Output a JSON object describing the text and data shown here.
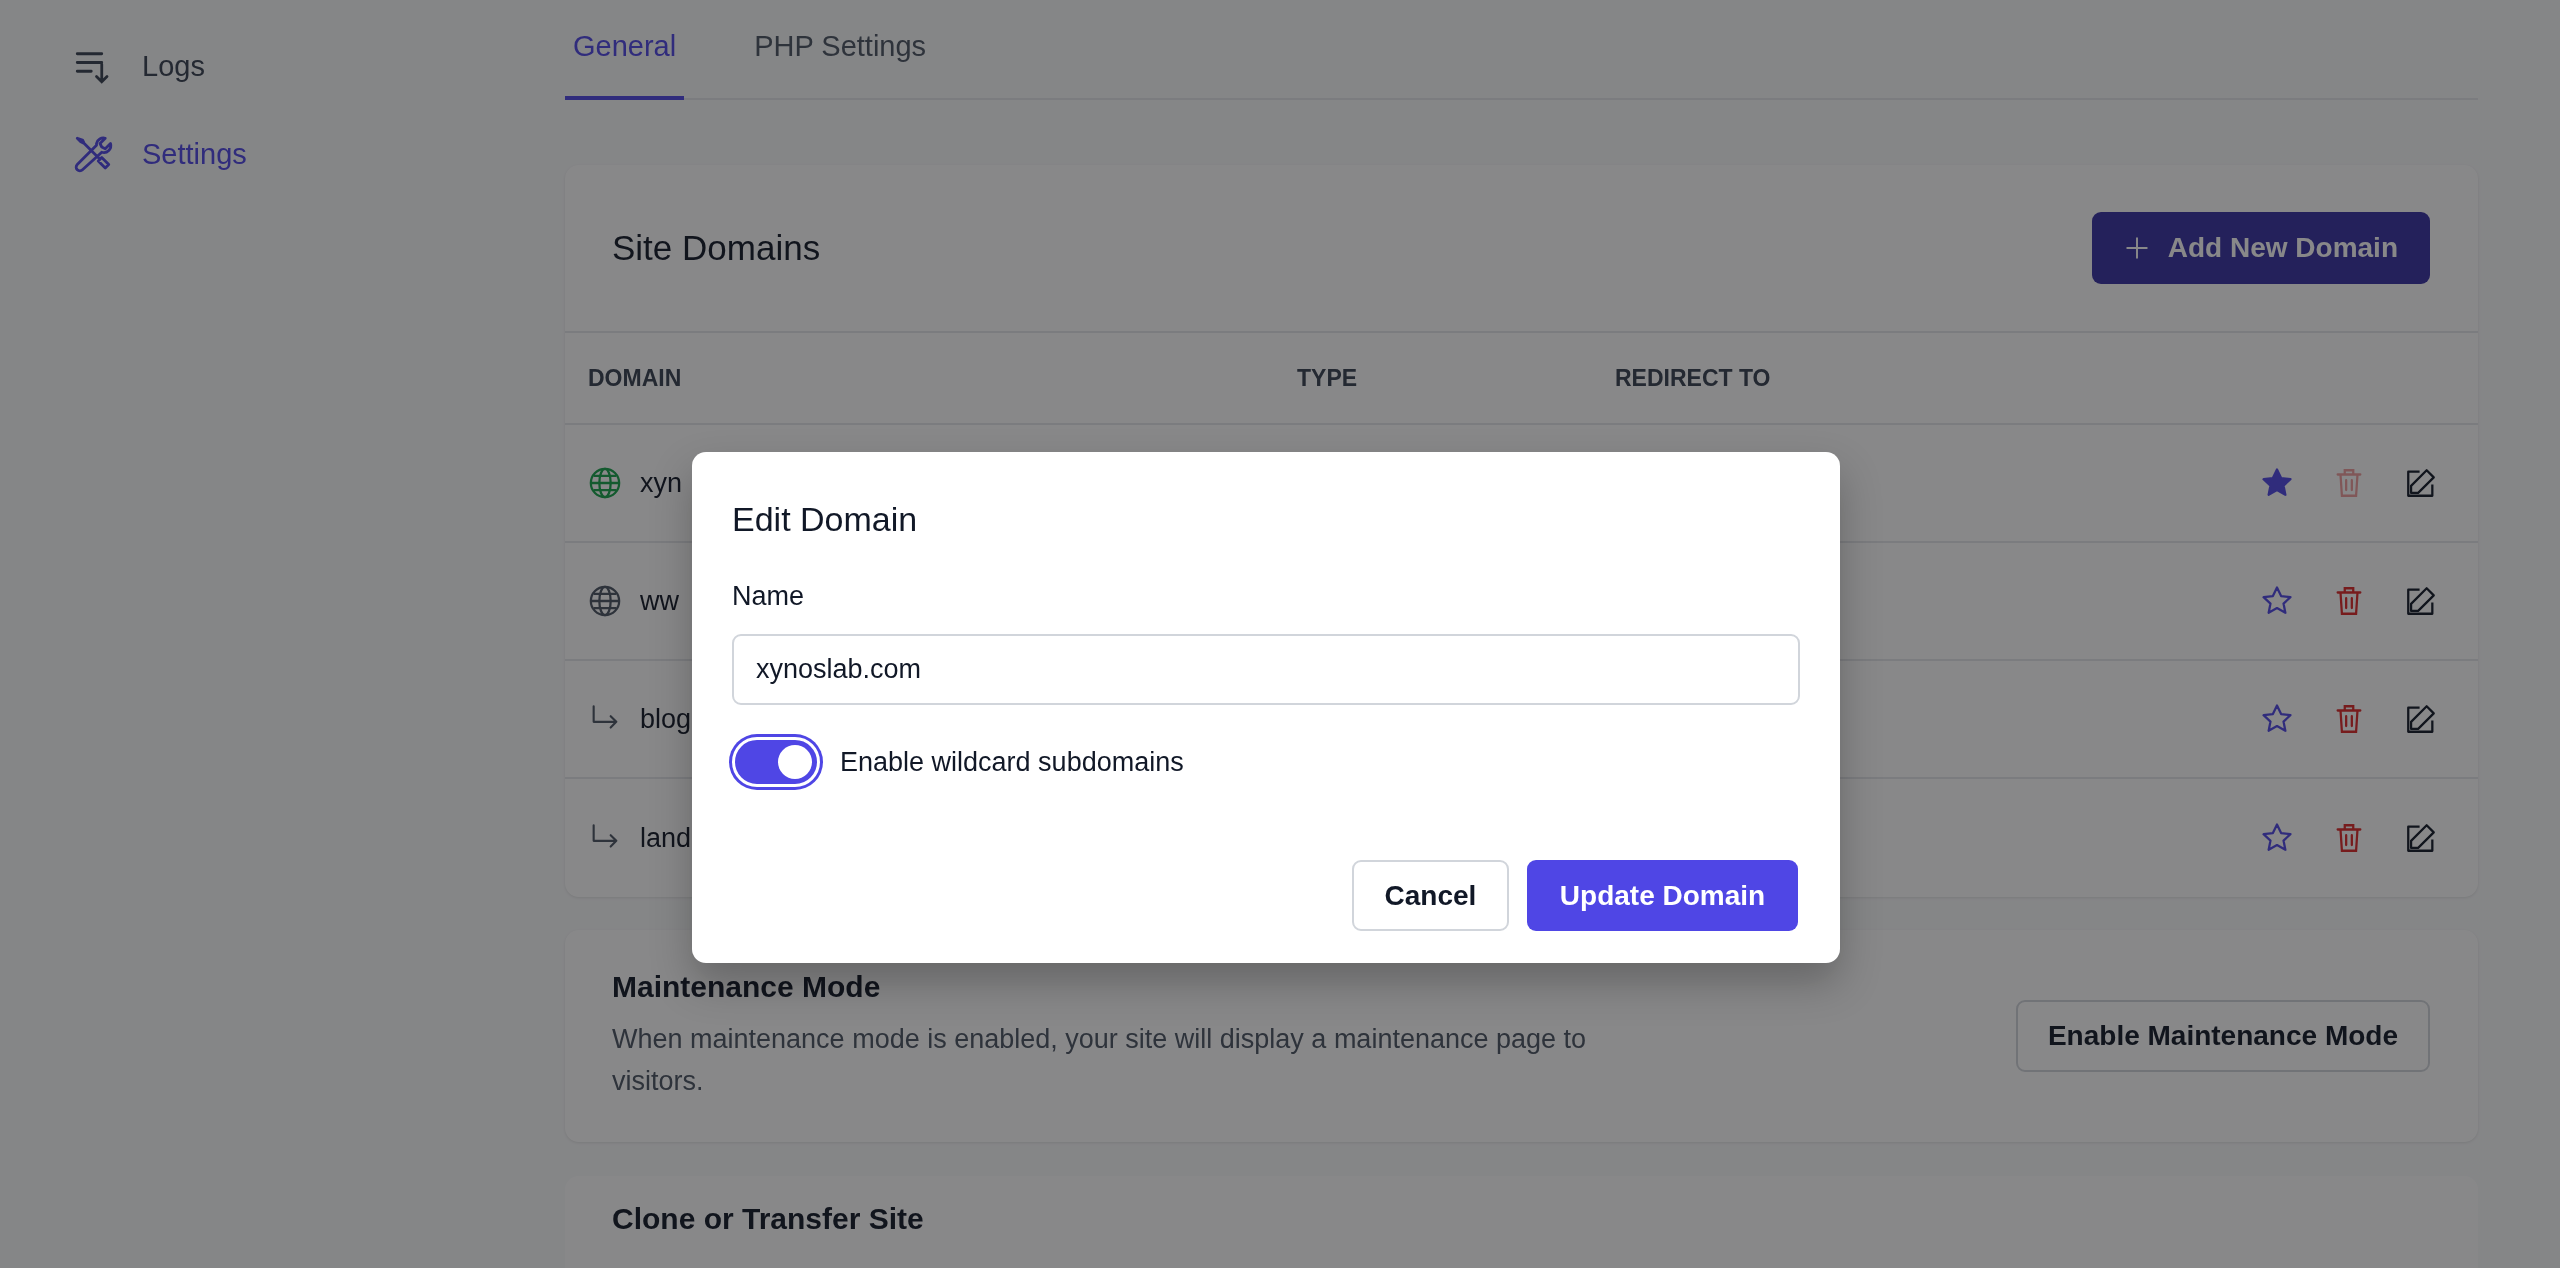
{
  "sidebar": {
    "items": [
      {
        "label": "Logs",
        "kind": "logs",
        "selected": false
      },
      {
        "label": "Settings",
        "kind": "settings",
        "selected": true
      }
    ]
  },
  "tabs": [
    {
      "label": "General",
      "selected": true
    },
    {
      "label": "PHP Settings",
      "selected": false
    }
  ],
  "site_domains": {
    "title": "Site Domains",
    "add_button": "Add New Domain",
    "columns": [
      "DOMAIN",
      "TYPE",
      "REDIRECT TO"
    ],
    "rows": [
      {
        "kind": "primary",
        "domain": "xyn",
        "starred": true,
        "delete_disabled": true
      },
      {
        "kind": "alias",
        "domain": "ww",
        "starred": false,
        "delete_disabled": false
      },
      {
        "kind": "redirect",
        "domain": "blog",
        "starred": false,
        "delete_disabled": false
      },
      {
        "kind": "redirect",
        "domain": "land",
        "starred": false,
        "delete_disabled": false
      }
    ]
  },
  "maintenance": {
    "title": "Maintenance Mode",
    "description": "When maintenance mode is enabled, your site will display a maintenance page to visitors.",
    "button": "Enable Maintenance Mode"
  },
  "clone": {
    "title": "Clone or Transfer Site"
  },
  "modal": {
    "title": "Edit Domain",
    "name_label": "Name",
    "name_value": "xynoslab.com",
    "wildcard": {
      "label": "Enable wildcard subdomains",
      "on": true
    },
    "buttons": [
      "Cancel",
      "Update Domain"
    ]
  }
}
